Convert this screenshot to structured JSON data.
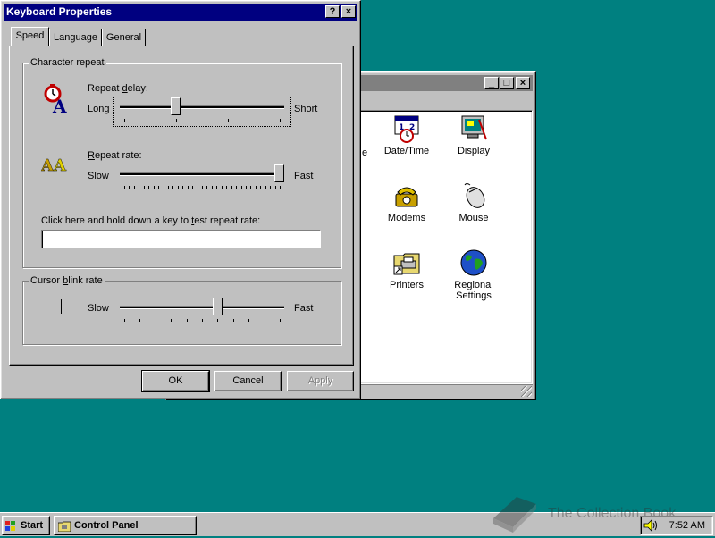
{
  "colors": {
    "desktop": "#008080",
    "title_active": "#000080",
    "title_inactive": "#808080",
    "face": "#c0c0c0"
  },
  "control_panel": {
    "icons": [
      {
        "label": "Date/Time",
        "icon": "date-time-icon"
      },
      {
        "label": "Display",
        "icon": "display-icon"
      },
      {
        "label": "Modems",
        "icon": "modem-phone-icon"
      },
      {
        "label": "Mouse",
        "icon": "mouse-icon"
      },
      {
        "label": "Printers",
        "icon": "printer-folder-icon"
      },
      {
        "label": "Regional Settings",
        "icon": "globe-icon"
      }
    ],
    "partial_label": "e",
    "buttons": {
      "minimize": "_",
      "maximize": "□",
      "close": "×"
    }
  },
  "dialog": {
    "title": "Keyboard Properties",
    "help_button": "?",
    "close_button": "×",
    "tabs": [
      "Speed",
      "Language",
      "General"
    ],
    "active_tab": "Speed",
    "character_repeat": {
      "group_label": "Character repeat",
      "repeat_delay": {
        "label_pre": "Repeat ",
        "label_u": "d",
        "label_post": "elay:",
        "min": "Long",
        "max": "Short",
        "value": 0.33,
        "ticks": 4
      },
      "repeat_rate": {
        "label_pre": "",
        "label_u": "R",
        "label_post": "epeat rate:",
        "min": "Slow",
        "max": "Fast",
        "value": 1.0,
        "ticks": 33
      },
      "test_label_pre": "Click here and hold down a key to ",
      "test_label_u": "t",
      "test_label_post": "est repeat rate:",
      "test_value": ""
    },
    "cursor_blink": {
      "group_label_pre": "Cursor ",
      "group_label_u": "b",
      "group_label_post": "link rate",
      "min": "Slow",
      "max": "Fast",
      "value": 0.6,
      "ticks": 11
    },
    "buttons": {
      "ok": "OK",
      "cancel": "Cancel",
      "apply": "Apply"
    }
  },
  "taskbar": {
    "start": "Start",
    "tasks": [
      {
        "label": "Control Panel"
      }
    ],
    "clock": "7:52 AM"
  },
  "watermark": "The Collection Book"
}
